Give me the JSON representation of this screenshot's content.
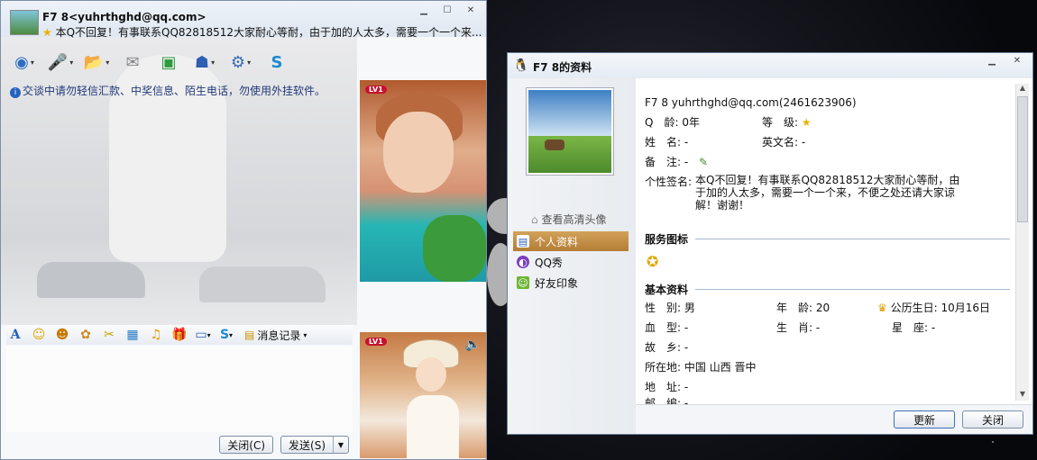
{
  "chat": {
    "title": "F7 8<yuhrthghd@qq.com>",
    "signature": "本Q不回复！有事联系QQ82818512大家耐心等耐，由于加的人太多，需要一个一个来...",
    "warning": "交谈中请勿轻信汇款、中奖信息、陌生电话，勿使用外挂软件。",
    "toolbar_icons": [
      "webcam-icon",
      "microphone-icon",
      "file-transfer-icon",
      "email-icon",
      "app-add-icon",
      "remote-assist-icon",
      "settings-icon",
      "qq-soso-icon"
    ],
    "format_icons": [
      "font-icon",
      "emoji-icon",
      "magic-face-icon",
      "doodle-icon",
      "screenshot-icon",
      "image-icon",
      "music-icon",
      "gift-icon",
      "screen-capture-icon",
      "soso-icon",
      "chat-history-icon"
    ],
    "msg_log_label": "消息记录",
    "close_label": "关闭(C)",
    "send_label": "发送(S)",
    "level_badge": "LV1"
  },
  "profile": {
    "window_title": "F7 8的资料",
    "hd_avatar_label": "查看高清头像",
    "nav": [
      {
        "label": "个人资料",
        "icon": "profile-card-icon",
        "active": true
      },
      {
        "label": "QQ秀",
        "icon": "qq-show-icon",
        "active": false
      },
      {
        "label": "好友印象",
        "icon": "friend-impression-icon",
        "active": false
      }
    ],
    "header": "F7 8  yuhrthghd@qq.com(2461623906)",
    "qage_label": "Q　龄:",
    "qage_value": "0年",
    "level_label": "等　级:",
    "name_label": "姓　名:",
    "name_value": "-",
    "en_name_label": "英文名:",
    "en_name_value": "-",
    "note_label": "备　注:",
    "note_value": "-",
    "sig_label": "个性签名:",
    "sig_value": "本Q不回复！有事联系QQ82818512大家耐心等耐，由于加的人太多，需要一个一个来，不便之处还请大家谅解！谢谢！",
    "service_section": "服务图标",
    "basic_section": "基本资料",
    "basic": {
      "gender_label": "性　别:",
      "gender_value": "男",
      "age_label": "年　龄:",
      "age_value": "20",
      "birthday_label": "公历生日:",
      "birthday_value": "10月16日",
      "blood_label": "血　型:",
      "blood_value": "-",
      "zodiac_label": "生　肖:",
      "zodiac_value": "-",
      "star_label": "星　座:",
      "star_value": "-",
      "hometown_label": "故　乡:",
      "hometown_value": "-",
      "location_label": "所在地:",
      "location_value": "中国 山西 晋中",
      "address_label": "地　址:",
      "address_value": "-",
      "postcode_label": "邮　编:",
      "postcode_value": "-"
    },
    "update_label": "更新",
    "close_label": "关闭"
  }
}
